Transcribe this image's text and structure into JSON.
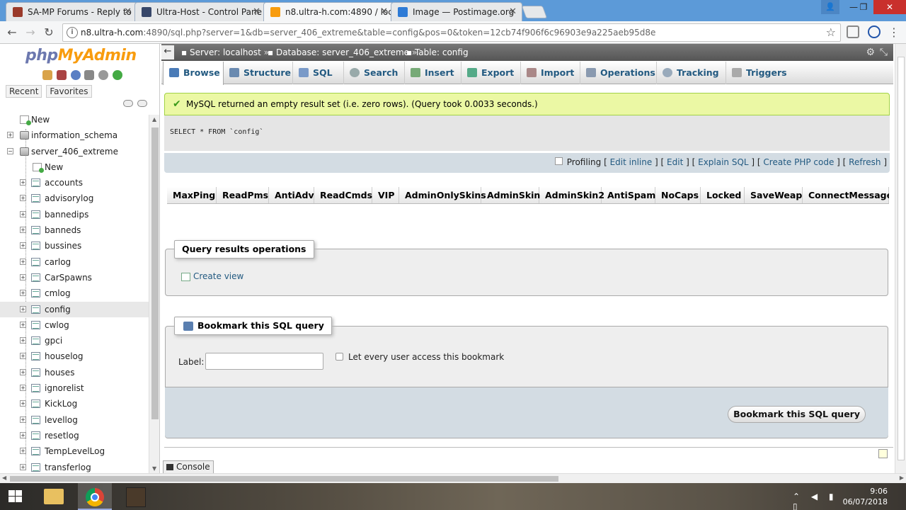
{
  "browser": {
    "tabs": [
      {
        "title": "SA-MP Forums - Reply to",
        "icon_color": "#9a3a2a",
        "active": false
      },
      {
        "title": "Ultra-Host - Control Pane",
        "icon_color": "#37476a",
        "active": false
      },
      {
        "title": "n8.ultra-h.com:4890 / loc",
        "icon_color": "#f89c0e",
        "active": true
      },
      {
        "title": "Image — Postimage.org",
        "icon_color": "#2e7bd6",
        "active": false
      }
    ],
    "url_host": "n8.ultra-h.com",
    "url_rest": ":4890/sql.php?server=1&db=server_406_extreme&table=config&pos=0&token=12cb74f906f6c96903e9a225aeb95d8e"
  },
  "sidebar": {
    "logo_php": "php",
    "logo_myadmin": "MyAdmin",
    "tab_recent": "Recent",
    "tab_favorites": "Favorites",
    "new_label": "New",
    "databases": [
      {
        "name": "information_schema"
      },
      {
        "name": "server_406_extreme"
      }
    ],
    "db_new_label": "New",
    "tables": [
      "accounts",
      "advisorylog",
      "bannedips",
      "banneds",
      "bussines",
      "carlog",
      "CarSpawns",
      "cmlog",
      "config",
      "cwlog",
      "gpci",
      "houselog",
      "houses",
      "ignorelist",
      "KickLog",
      "levellog",
      "resetlog",
      "TempLevelLog",
      "transferlog"
    ],
    "selected_table": "config"
  },
  "breadcrumb": {
    "server": "Server: localhost",
    "database": "Database: server_406_extreme",
    "table": "Table: config"
  },
  "menu": {
    "browse": "Browse",
    "structure": "Structure",
    "sql": "SQL",
    "search": "Search",
    "insert": "Insert",
    "export": "Export",
    "import": "Import",
    "operations": "Operations",
    "tracking": "Tracking",
    "triggers": "Triggers"
  },
  "result": {
    "message": "MySQL returned an empty result set (i.e. zero rows). (Query took 0.0033 seconds.)",
    "query": "SELECT * FROM `config`",
    "profiling": "Profiling",
    "edit_inline": "Edit inline",
    "edit": "Edit",
    "explain_sql": "Explain SQL",
    "create_php_code": "Create PHP code",
    "refresh": "Refresh",
    "columns": [
      "MaxPing",
      "ReadPms",
      "AntiAdv",
      "ReadCmds",
      "VIP",
      "AdminOnlySkins",
      "AdminSkin",
      "AdminSkin2",
      "AntiSpam",
      "NoCaps",
      "Locked",
      "SaveWeap",
      "ConnectMessages"
    ]
  },
  "query_ops": {
    "legend": "Query results operations",
    "create_view": "Create view"
  },
  "bookmark": {
    "legend": "Bookmark this SQL query",
    "label": "Label:",
    "label_value": "",
    "share_label": "Let every user access this bookmark",
    "button": "Bookmark this SQL query"
  },
  "console": {
    "label": "Console"
  },
  "taskbar": {
    "time": "9:06",
    "date": "06/07/2018"
  }
}
